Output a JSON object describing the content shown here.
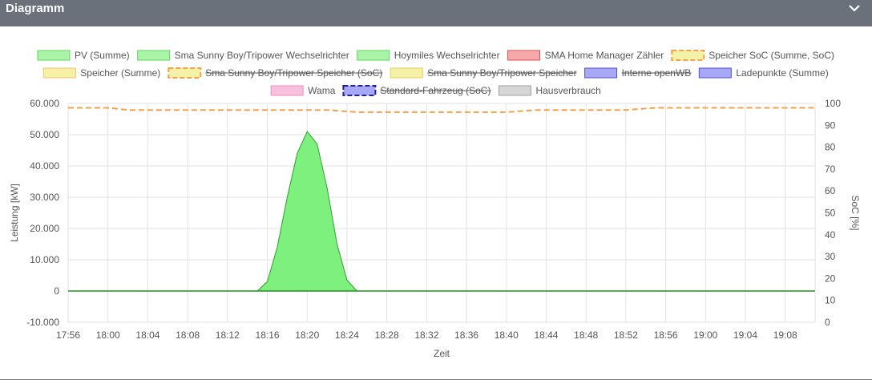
{
  "panel": {
    "title": "Diagramm",
    "collapse_icon": "chevron-down-icon"
  },
  "colors": {
    "header_bg": "#6a717b",
    "pv_fill": "#7ef07e",
    "pv_stroke": "#2f9e2f",
    "soc_line": "#f4a24a",
    "grid": "#e2e2e2"
  },
  "chart_data": {
    "type": "area",
    "xlabel": "Zeit",
    "ylabel_left": "Leistung [kW]",
    "ylabel_right": "SoC [%]",
    "x_ticks": [
      "17:56",
      "18:00",
      "18:04",
      "18:08",
      "18:12",
      "18:16",
      "18:20",
      "18:24",
      "18:28",
      "18:32",
      "18:36",
      "18:40",
      "18:44",
      "18:48",
      "18:52",
      "18:56",
      "19:00",
      "19:04",
      "19:08"
    ],
    "x_range": [
      "17:56",
      "19:11"
    ],
    "y_left_ticks": [
      "60.000",
      "50.000",
      "40.000",
      "30.000",
      "20.000",
      "10.000",
      "0",
      "-10.000"
    ],
    "y_left_range": [
      -10000,
      60000
    ],
    "y_right_ticks": [
      "100",
      "90",
      "80",
      "70",
      "60",
      "50",
      "40",
      "30",
      "20",
      "10",
      "0"
    ],
    "y_right_range": [
      0,
      100
    ],
    "grid": true,
    "legend_position": "top",
    "legend": [
      {
        "name": "PV (Summe)",
        "fill": "#a8f5a8",
        "stroke": "#5fd35f",
        "dashed": false,
        "hidden": false
      },
      {
        "name": "Sma Sunny Boy/Tripower Wechselrichter",
        "fill": "#a8f5a8",
        "stroke": "#5fd35f",
        "dashed": false,
        "hidden": false
      },
      {
        "name": "Hoymiles Wechselrichter",
        "fill": "#a8f5a8",
        "stroke": "#5fd35f",
        "dashed": false,
        "hidden": false
      },
      {
        "name": "SMA Home Manager Zähler",
        "fill": "#f8a8a8",
        "stroke": "#e05050",
        "dashed": false,
        "hidden": false
      },
      {
        "name": "Speicher SoC (Summe, SoC)",
        "fill": "#f5f2a8",
        "stroke": "#f4a24a",
        "dashed": true,
        "hidden": false
      },
      {
        "name": "Speicher (Summe)",
        "fill": "#f5f2a8",
        "stroke": "#f4c070",
        "dashed": false,
        "hidden": false
      },
      {
        "name": "Sma Sunny Boy/Tripower Speicher (SoC)",
        "fill": "#f5f2a8",
        "stroke": "#f4a24a",
        "dashed": true,
        "hidden": true
      },
      {
        "name": "Sma Sunny Boy/Tripower Speicher",
        "fill": "#f5f2a8",
        "stroke": "#e0d060",
        "dashed": false,
        "hidden": true
      },
      {
        "name": "Interne openWB",
        "fill": "#a8a8f8",
        "stroke": "#5050d0",
        "dashed": false,
        "hidden": true
      },
      {
        "name": "Ladepunkte (Summe)",
        "fill": "#a8a8f8",
        "stroke": "#5050d0",
        "dashed": false,
        "hidden": false
      },
      {
        "name": "Wama",
        "fill": "#f8c0dc",
        "stroke": "#e890c0",
        "dashed": false,
        "hidden": false
      },
      {
        "name": "Standard-Fahrzeug (SoC)",
        "fill": "#a8a8f8",
        "stroke": "#2020a0",
        "dashed": true,
        "hidden": true
      },
      {
        "name": "Hausverbrauch",
        "fill": "#d6d6d6",
        "stroke": "#a0a0a0",
        "dashed": false,
        "hidden": false
      }
    ],
    "series": [
      {
        "name": "PV (Summe)",
        "kind": "area",
        "axis": "left",
        "points": [
          [
            "17:56",
            0
          ],
          [
            "18:15",
            0
          ],
          [
            "18:16",
            3000
          ],
          [
            "18:17",
            14000
          ],
          [
            "18:18",
            30000
          ],
          [
            "18:19",
            44000
          ],
          [
            "18:20",
            51000
          ],
          [
            "18:21",
            47000
          ],
          [
            "18:22",
            33000
          ],
          [
            "18:23",
            15000
          ],
          [
            "18:24",
            3500
          ],
          [
            "18:25",
            0
          ],
          [
            "19:11",
            0
          ]
        ]
      },
      {
        "name": "Speicher SoC (Summe, SoC)",
        "kind": "line",
        "axis": "right",
        "points": [
          [
            "17:56",
            98
          ],
          [
            "18:00",
            98
          ],
          [
            "18:02",
            97
          ],
          [
            "18:18",
            97
          ],
          [
            "18:22",
            97
          ],
          [
            "18:25",
            96
          ],
          [
            "18:40",
            96
          ],
          [
            "18:43",
            97
          ],
          [
            "18:52",
            97
          ],
          [
            "18:55",
            98
          ],
          [
            "19:11",
            98
          ]
        ]
      }
    ]
  }
}
